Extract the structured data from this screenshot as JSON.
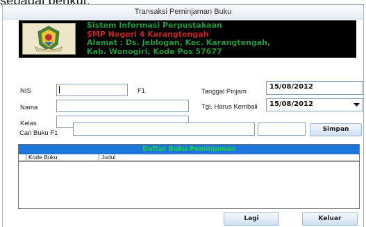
{
  "caption_fragment": "sebagai berikut:",
  "window": {
    "title": "Transaksi Peminjaman Buku"
  },
  "header": {
    "line1": "Sistem Informasi Perpustakaan",
    "line2": "SMP Negeri 4 Karangtengah",
    "line3": "Alamat : Ds. Jeblogan, Kec. Karangtengah,",
    "line4": "Kab. Wonogiri, Kode Pos 57677",
    "colors": {
      "background": "#000000",
      "line_green": "#1f9b3a",
      "line_red": "#c42525"
    },
    "logo_icon": "regency-emblem-icon"
  },
  "form": {
    "nis_label": "NIS",
    "nis_value": "",
    "nis_hint": "F1",
    "nama_label": "Nama",
    "nama_value": "",
    "kelas_label": "Kelas",
    "kelas_value": "",
    "tanggal_pinjam_label": "Tanggal Pinjam",
    "tanggal_pinjam_value": "15/08/2012",
    "tgl_kembali_label": "Tgl. Harus Kembali",
    "tgl_kembali_value": "15/08/2012",
    "cari_buku_label": "Cari Buku  F1",
    "cari_buku_value": "",
    "cari_buku_extra_value": ""
  },
  "buttons": {
    "simpan": "Simpan",
    "lagi": "Lagi",
    "keluar": "Keluar"
  },
  "grid": {
    "title": "Daftar Buku Peminjaman",
    "columns": [
      "Kode Buku",
      "Judul"
    ],
    "rows": [],
    "colors": {
      "title_bg": "#1f75d9",
      "title_text": "#19d63a"
    }
  }
}
